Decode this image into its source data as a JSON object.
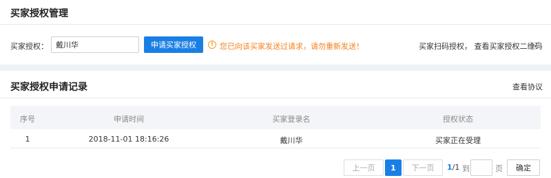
{
  "header": {
    "title": "买家授权管理"
  },
  "auth": {
    "label": "买家授权：",
    "input_value": "戴川华",
    "submit_label": "申请买家授权",
    "warning_text": "您已向该买家发送过请求，请勿重新发送！",
    "qr_link": "买家扫码授权， 查看买家授权二维码"
  },
  "records": {
    "title": "买家授权申请记录",
    "agreement_link": "查看协议",
    "columns": [
      "序号",
      "申请时间",
      "买家登录名",
      "授权状态"
    ],
    "rows": [
      {
        "index": "1",
        "time": "2018-11-01 18:16:26",
        "buyer": "戴川华",
        "status": "买家正在受理"
      }
    ]
  },
  "pagination": {
    "prev_label": "上一页",
    "current_page": "1",
    "next_label": "下一页",
    "info_current": "1",
    "info_total": "/1",
    "to_label": "到",
    "page_label": "页",
    "goto_value": "",
    "confirm_label": "确定"
  },
  "colors": {
    "accent": "#1a7fe5",
    "warning": "#f5801d",
    "band": "#eef1f7"
  },
  "icons": {
    "warning": "warning-circle-icon",
    "chevron": "chevron-down-icon"
  }
}
